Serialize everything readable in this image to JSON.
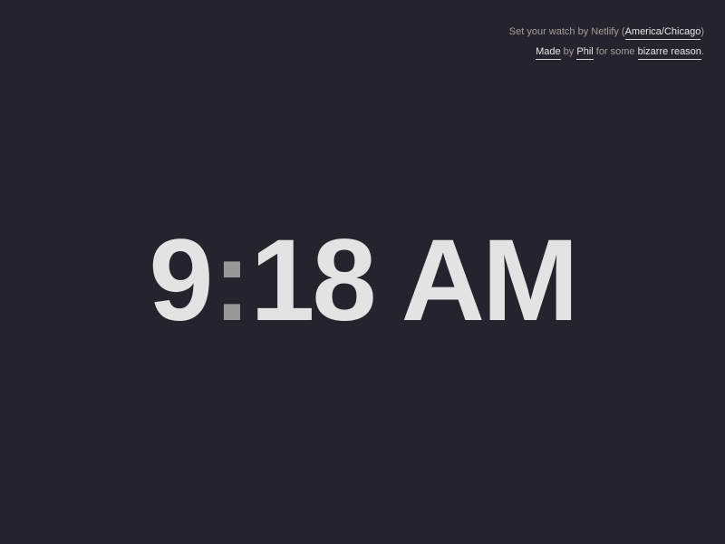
{
  "info": {
    "line1_prefix": "Set your watch by Netlify (",
    "timezone_link": "America/Chicago",
    "line1_suffix": ")",
    "made_link": "Made",
    "by_text": " by ",
    "author_link": "Phil",
    "for_text": " for some ",
    "reason_link": "bizarre reason",
    "line2_suffix": "."
  },
  "clock": {
    "hours": "9",
    "separator": ":",
    "minutes": "18",
    "period": "AM"
  },
  "colors": {
    "background": "#25242d",
    "clock_text": "#e3e3e3",
    "colon": "#999999",
    "info_text": "#a59f9b",
    "link_text": "#e6e6e6"
  }
}
